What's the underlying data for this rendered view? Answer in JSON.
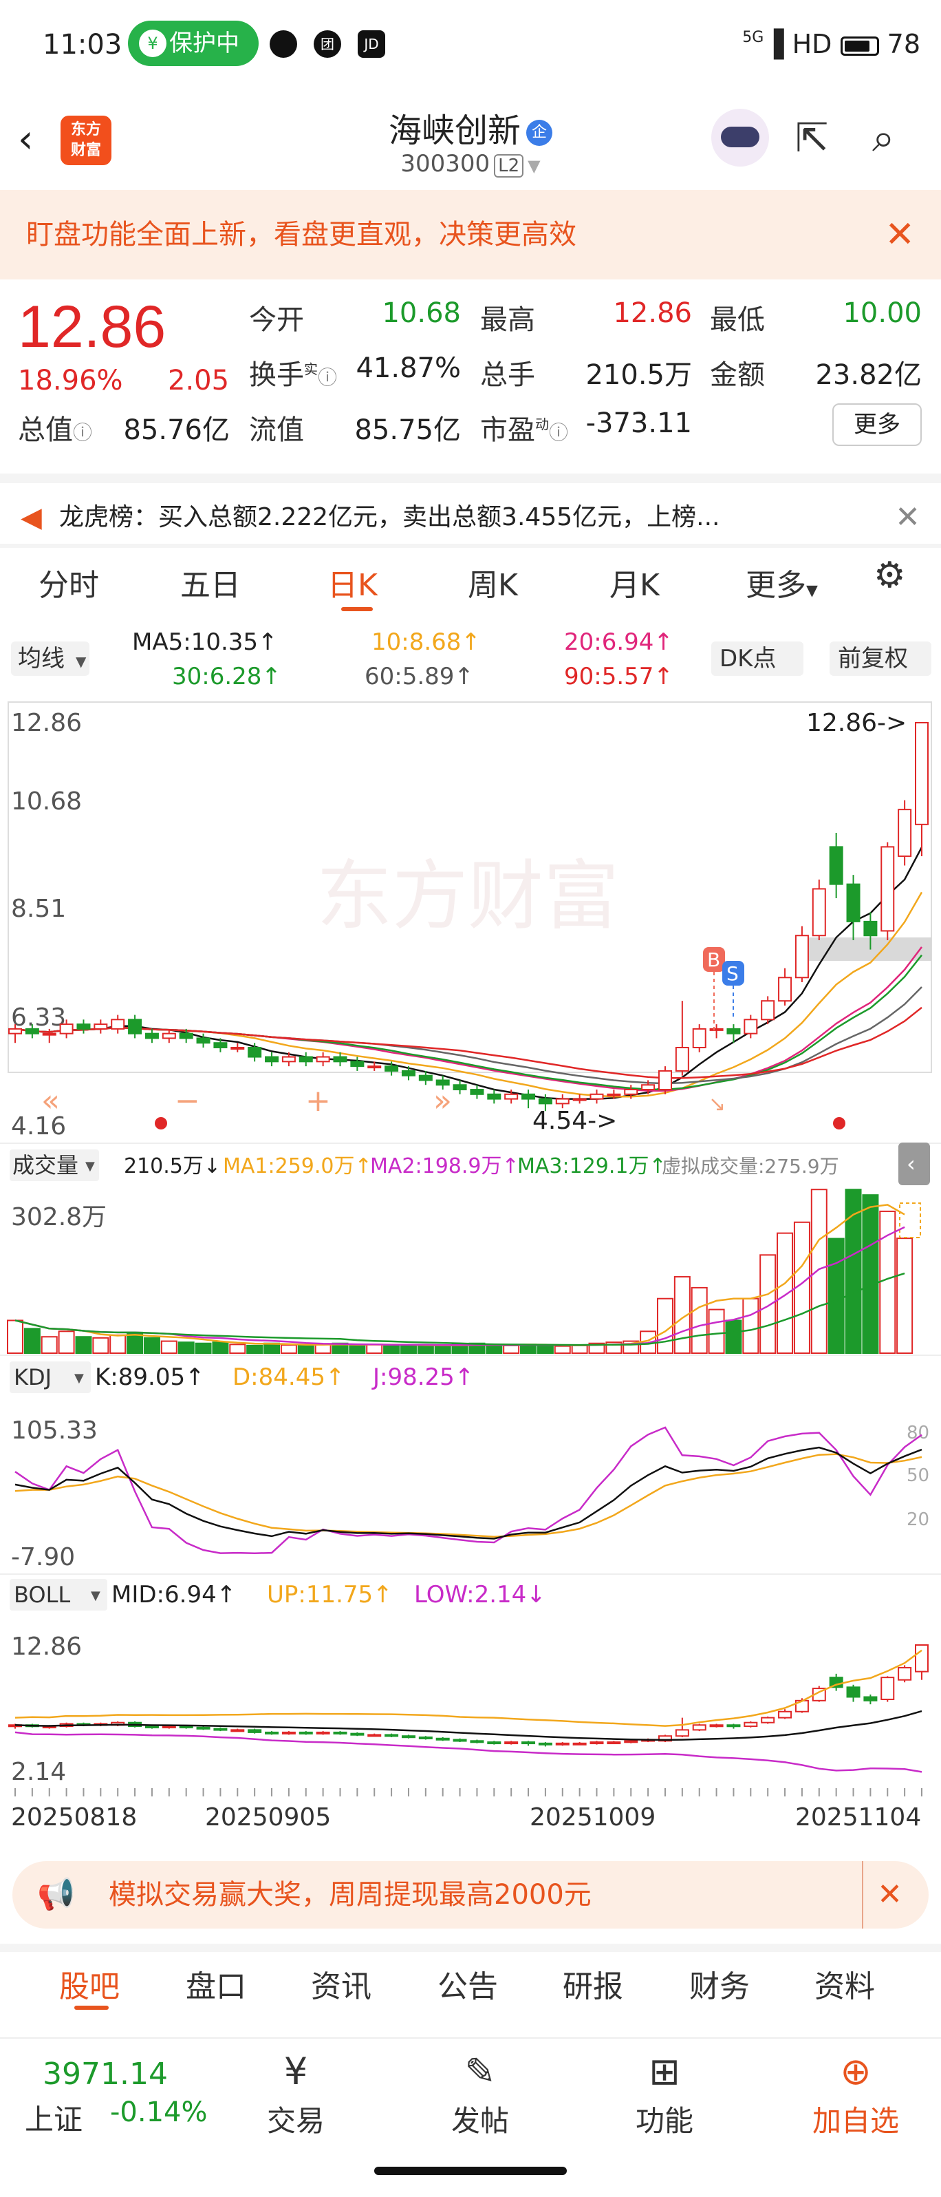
{
  "status_bar": {
    "time": "11:03",
    "protect": "保护中",
    "icon_a": "团",
    "icon_b": "JD",
    "network": "5G",
    "hd": "HD",
    "battery": "78"
  },
  "header": {
    "logo": "东方财富",
    "title": "海峡创新",
    "code": "300300",
    "level": "L2"
  },
  "banner": {
    "text": "盯盘功能全面上新，看盘更直观，决策更高效"
  },
  "quote": {
    "price": "12.86",
    "change_pct": "18.96%",
    "change": "2.05",
    "open_label": "今开",
    "open": "10.68",
    "high_label": "最高",
    "high": "12.86",
    "low_label": "最低",
    "low": "10.00",
    "turnover_label": "换手",
    "turnover_sup": "实",
    "turnover": "41.87%",
    "volume_label": "总手",
    "volume": "210.5万",
    "amount_label": "金额",
    "amount": "23.82亿",
    "mktcap_label": "总值",
    "mktcap": "85.76亿",
    "float_label": "流值",
    "float": "85.75亿",
    "pe_label": "市盈",
    "pe_sup": "动",
    "pe": "-373.11",
    "more": "更多"
  },
  "dragon": {
    "text": "龙虎榜：买入总额2.222亿元，卖出总额3.455亿元，上榜..."
  },
  "tabs": [
    "分时",
    "五日",
    "日K",
    "周K",
    "月K",
    "更多"
  ],
  "kline": {
    "ma_toggle": "均线",
    "dk": "DK点",
    "adjust": "前复权",
    "ma5": "MA5:10.35↑",
    "ma10": "10:8.68↑",
    "ma20": "20:6.94↑",
    "ma30": "30:6.28↑",
    "ma60": "60:5.89↑",
    "ma90": "90:5.57↑",
    "ymax": "12.86",
    "y2": "10.68",
    "y3": "8.51",
    "y4": "6.33",
    "ymin": "4.16",
    "max_tag": "12.86->",
    "min_tag": "4.54->",
    "watermark": "东方财富",
    "b_tag": "B",
    "s_tag": "S"
  },
  "volume": {
    "label": "成交量",
    "value": "210.5万↓",
    "ma1": "MA1:259.0万↑",
    "ma2": "MA2:198.9万↑",
    "ma3": "MA3:129.1万↑",
    "virtual": "虚拟成交量:275.9万",
    "ymax": "302.8万"
  },
  "kdj": {
    "label": "KDJ",
    "k": "K:89.05↑",
    "d": "D:84.45↑",
    "j": "J:98.25↑",
    "ymax": "105.33",
    "ymin": "-7.90",
    "l80": "80",
    "l50": "50",
    "l20": "20"
  },
  "boll": {
    "label": "BOLL",
    "mid": "MID:6.94↑",
    "up": "UP:11.75↑",
    "low": "LOW:2.14↓",
    "ymax": "12.86",
    "ymin": "2.14"
  },
  "dates": [
    "20250818",
    "20250905",
    "20251009",
    "20251104"
  ],
  "promo": {
    "text": "模拟交易赢大奖，周周提现最高2000元"
  },
  "bottom_tabs": [
    "股吧",
    "盘口",
    "资讯",
    "公告",
    "研报",
    "财务",
    "资料"
  ],
  "index": {
    "value": "3971.14",
    "name": "上证",
    "change": "-0.14%"
  },
  "nav": [
    "交易",
    "发帖",
    "功能",
    "加自选"
  ],
  "colors": {
    "up": "#e02727",
    "down": "#1c9a2b",
    "accent": "#e8541e"
  },
  "chart_data": {
    "type": "candlestick",
    "note_series": [
      "MA5",
      "MA10",
      "MA20",
      "MA30",
      "MA60",
      "MA90"
    ],
    "ylim": [
      4.16,
      12.86
    ],
    "candles": [
      [
        6.2,
        6.3,
        6.0,
        6.4
      ],
      [
        6.3,
        6.2,
        6.1,
        6.4
      ],
      [
        6.2,
        6.2,
        6.0,
        6.3
      ],
      [
        6.2,
        6.4,
        6.1,
        6.5
      ],
      [
        6.4,
        6.3,
        6.2,
        6.5
      ],
      [
        6.3,
        6.4,
        6.2,
        6.5
      ],
      [
        6.3,
        6.5,
        6.2,
        6.6
      ],
      [
        6.5,
        6.2,
        6.1,
        6.6
      ],
      [
        6.2,
        6.1,
        6.0,
        6.3
      ],
      [
        6.1,
        6.2,
        6.0,
        6.3
      ],
      [
        6.2,
        6.1,
        6.0,
        6.3
      ],
      [
        6.1,
        6.0,
        5.9,
        6.2
      ],
      [
        6.0,
        5.9,
        5.8,
        6.1
      ],
      [
        5.9,
        5.9,
        5.8,
        6.0
      ],
      [
        5.9,
        5.7,
        5.6,
        6.0
      ],
      [
        5.7,
        5.6,
        5.5,
        5.8
      ],
      [
        5.6,
        5.7,
        5.5,
        5.8
      ],
      [
        5.7,
        5.6,
        5.5,
        5.8
      ],
      [
        5.6,
        5.7,
        5.5,
        5.8
      ],
      [
        5.7,
        5.6,
        5.5,
        5.8
      ],
      [
        5.6,
        5.5,
        5.4,
        5.7
      ],
      [
        5.5,
        5.5,
        5.4,
        5.6
      ],
      [
        5.5,
        5.4,
        5.3,
        5.6
      ],
      [
        5.4,
        5.3,
        5.2,
        5.5
      ],
      [
        5.3,
        5.2,
        5.1,
        5.4
      ],
      [
        5.2,
        5.1,
        5.0,
        5.3
      ],
      [
        5.1,
        5.0,
        4.9,
        5.2
      ],
      [
        5.0,
        4.9,
        4.8,
        5.1
      ],
      [
        4.9,
        4.8,
        4.7,
        5.0
      ],
      [
        4.8,
        4.9,
        4.7,
        5.0
      ],
      [
        4.9,
        4.8,
        4.6,
        5.0
      ],
      [
        4.8,
        4.7,
        4.54,
        4.9
      ],
      [
        4.7,
        4.8,
        4.6,
        4.9
      ],
      [
        4.8,
        4.8,
        4.7,
        4.9
      ],
      [
        4.8,
        4.9,
        4.7,
        5.0
      ],
      [
        4.9,
        4.9,
        4.8,
        5.0
      ],
      [
        4.9,
        5.0,
        4.8,
        5.1
      ],
      [
        5.0,
        5.1,
        4.9,
        5.2
      ],
      [
        5.0,
        5.4,
        4.9,
        5.5
      ],
      [
        5.4,
        5.9,
        5.3,
        6.9
      ],
      [
        5.9,
        6.3,
        5.8,
        6.4
      ],
      [
        6.3,
        6.3,
        6.1,
        6.4
      ],
      [
        6.3,
        6.2,
        6.0,
        6.4
      ],
      [
        6.2,
        6.5,
        6.1,
        6.6
      ],
      [
        6.5,
        6.9,
        6.4,
        7.0
      ],
      [
        6.9,
        7.4,
        6.8,
        7.6
      ],
      [
        7.4,
        8.3,
        7.3,
        8.5
      ],
      [
        8.3,
        9.3,
        8.2,
        9.5
      ],
      [
        10.2,
        9.4,
        9.1,
        10.5
      ],
      [
        9.4,
        8.6,
        8.2,
        9.6
      ],
      [
        8.6,
        8.3,
        8.0,
        8.8
      ],
      [
        8.4,
        10.2,
        8.2,
        10.3
      ],
      [
        10.0,
        11.0,
        9.8,
        11.2
      ],
      [
        10.68,
        12.86,
        10.0,
        12.86
      ]
    ],
    "volume_max": 302.8,
    "volume": [
      60,
      45,
      30,
      40,
      30,
      28,
      33,
      38,
      28,
      22,
      20,
      18,
      20,
      16,
      14,
      18,
      15,
      14,
      16,
      18,
      14,
      16,
      14,
      15,
      14,
      12,
      16,
      18,
      15,
      14,
      16,
      15,
      13,
      14,
      18,
      20,
      22,
      40,
      100,
      140,
      120,
      80,
      60,
      100,
      180,
      220,
      240,
      300,
      210,
      300,
      290,
      260,
      210.5
    ]
  }
}
